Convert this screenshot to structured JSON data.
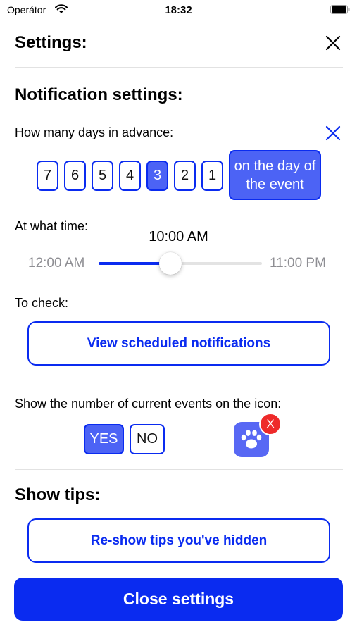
{
  "status_bar": {
    "carrier": "Operátor",
    "time": "18:32"
  },
  "header": {
    "title": "Settings:"
  },
  "notifications": {
    "section_title": "Notification settings:",
    "days_label": "How many days in advance:",
    "days": [
      "7",
      "6",
      "5",
      "4",
      "3",
      "2",
      "1"
    ],
    "selected_day": "3",
    "on_day_label": "on the day of the event",
    "time_label": "At what time:",
    "time_value": "10:00 AM",
    "time_min": "12:00 AM",
    "time_max": "11:00 PM",
    "time_fraction": 0.44,
    "check_label": "To check:",
    "view_button": "View scheduled notifications"
  },
  "icon_badge": {
    "label": "Show the number of current events on the icon:",
    "yes": "YES",
    "no": "NO",
    "selected": "YES",
    "badge_text": "X",
    "app_icon": "paw-icon"
  },
  "tips": {
    "section_title": "Show tips:",
    "reshow_button": "Re-show tips you've hidden"
  },
  "footer": {
    "close_button": "Close settings"
  },
  "colors": {
    "accent": "#0a2bf0",
    "selected_fill": "#4c63f5",
    "badge": "#ee2a2a"
  }
}
